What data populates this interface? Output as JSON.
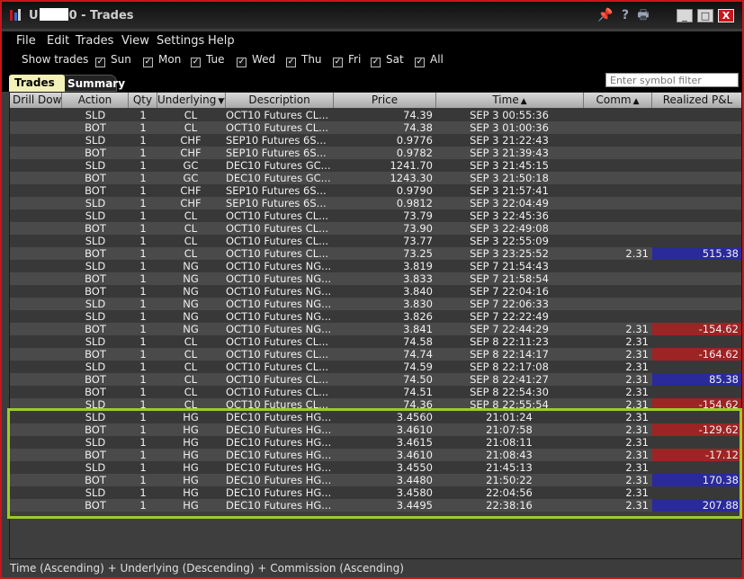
{
  "window": {
    "title_prefix": "U",
    "title_suffix": "0 - Trades"
  },
  "menu": [
    "File",
    "Edit",
    "Trades",
    "View",
    "Settings",
    "Help"
  ],
  "show_trades_label": "Show trades",
  "days": [
    {
      "label": "Sun",
      "checked": true
    },
    {
      "label": "Mon",
      "checked": true
    },
    {
      "label": "Tue",
      "checked": true
    },
    {
      "label": "Wed",
      "checked": true
    },
    {
      "label": "Thu",
      "checked": true
    },
    {
      "label": "Fri",
      "checked": true
    },
    {
      "label": "Sat",
      "checked": true
    },
    {
      "label": "All",
      "checked": true
    }
  ],
  "tabs": {
    "trades": "Trades",
    "summary": "Summary"
  },
  "filter": {
    "placeholder": "Enter symbol filter"
  },
  "columns": {
    "drill": "Drill Down",
    "action": "Action",
    "qty": "Qty",
    "underlying": "Underlying",
    "description": "Description",
    "price": "Price",
    "time": "Time",
    "comm": "Comm",
    "pnl": "Realized P&L"
  },
  "rows": [
    {
      "action": "SLD",
      "qty": "1",
      "und": "CL",
      "desc": "OCT10 Futures CL...",
      "price": "74.39",
      "time": "SEP 3 00:55:36",
      "comm": "",
      "pnl": ""
    },
    {
      "action": "BOT",
      "qty": "1",
      "und": "CL",
      "desc": "OCT10 Futures CL...",
      "price": "74.38",
      "time": "SEP 3 01:00:36",
      "comm": "",
      "pnl": ""
    },
    {
      "action": "SLD",
      "qty": "1",
      "und": "CHF",
      "desc": "SEP10 Futures 6S...",
      "price": "0.9776",
      "time": "SEP 3 21:22:43",
      "comm": "",
      "pnl": ""
    },
    {
      "action": "BOT",
      "qty": "1",
      "und": "CHF",
      "desc": "SEP10 Futures 6S...",
      "price": "0.9782",
      "time": "SEP 3 21:39:43",
      "comm": "",
      "pnl": ""
    },
    {
      "action": "SLD",
      "qty": "1",
      "und": "GC",
      "desc": "DEC10 Futures GC...",
      "price": "1241.70",
      "time": "SEP 3 21:45:15",
      "comm": "",
      "pnl": ""
    },
    {
      "action": "BOT",
      "qty": "1",
      "und": "GC",
      "desc": "DEC10 Futures GC...",
      "price": "1243.30",
      "time": "SEP 3 21:50:18",
      "comm": "",
      "pnl": ""
    },
    {
      "action": "BOT",
      "qty": "1",
      "und": "CHF",
      "desc": "SEP10 Futures 6S...",
      "price": "0.9790",
      "time": "SEP 3 21:57:41",
      "comm": "",
      "pnl": ""
    },
    {
      "action": "SLD",
      "qty": "1",
      "und": "CHF",
      "desc": "SEP10 Futures 6S...",
      "price": "0.9812",
      "time": "SEP 3 22:04:49",
      "comm": "",
      "pnl": ""
    },
    {
      "action": "SLD",
      "qty": "1",
      "und": "CL",
      "desc": "OCT10 Futures CL...",
      "price": "73.79",
      "time": "SEP 3 22:45:36",
      "comm": "",
      "pnl": ""
    },
    {
      "action": "BOT",
      "qty": "1",
      "und": "CL",
      "desc": "OCT10 Futures CL...",
      "price": "73.90",
      "time": "SEP 3 22:49:08",
      "comm": "",
      "pnl": ""
    },
    {
      "action": "SLD",
      "qty": "1",
      "und": "CL",
      "desc": "OCT10 Futures CL...",
      "price": "73.77",
      "time": "SEP 3 22:55:09",
      "comm": "",
      "pnl": ""
    },
    {
      "action": "BOT",
      "qty": "1",
      "und": "CL",
      "desc": "OCT10 Futures CL...",
      "price": "73.25",
      "time": "SEP 3 23:25:52",
      "comm": "2.31",
      "pnl": "515.38",
      "pnl_sign": "pos"
    },
    {
      "action": "SLD",
      "qty": "1",
      "und": "NG",
      "desc": "OCT10 Futures NG...",
      "price": "3.819",
      "time": "SEP 7 21:54:43",
      "comm": "",
      "pnl": ""
    },
    {
      "action": "BOT",
      "qty": "1",
      "und": "NG",
      "desc": "OCT10 Futures NG...",
      "price": "3.833",
      "time": "SEP 7 21:58:54",
      "comm": "",
      "pnl": ""
    },
    {
      "action": "BOT",
      "qty": "1",
      "und": "NG",
      "desc": "OCT10 Futures NG...",
      "price": "3.840",
      "time": "SEP 7 22:04:16",
      "comm": "",
      "pnl": ""
    },
    {
      "action": "SLD",
      "qty": "1",
      "und": "NG",
      "desc": "OCT10 Futures NG...",
      "price": "3.830",
      "time": "SEP 7 22:06:33",
      "comm": "",
      "pnl": ""
    },
    {
      "action": "SLD",
      "qty": "1",
      "und": "NG",
      "desc": "OCT10 Futures NG...",
      "price": "3.826",
      "time": "SEP 7 22:22:49",
      "comm": "",
      "pnl": ""
    },
    {
      "action": "BOT",
      "qty": "1",
      "und": "NG",
      "desc": "OCT10 Futures NG...",
      "price": "3.841",
      "time": "SEP 7 22:44:29",
      "comm": "2.31",
      "pnl": "-154.62",
      "pnl_sign": "neg"
    },
    {
      "action": "SLD",
      "qty": "1",
      "und": "CL",
      "desc": "OCT10 Futures CL...",
      "price": "74.58",
      "time": "SEP 8 22:11:23",
      "comm": "2.31",
      "pnl": ""
    },
    {
      "action": "BOT",
      "qty": "1",
      "und": "CL",
      "desc": "OCT10 Futures CL...",
      "price": "74.74",
      "time": "SEP 8 22:14:17",
      "comm": "2.31",
      "pnl": "-164.62",
      "pnl_sign": "neg"
    },
    {
      "action": "SLD",
      "qty": "1",
      "und": "CL",
      "desc": "OCT10 Futures CL...",
      "price": "74.59",
      "time": "SEP 8 22:17:08",
      "comm": "2.31",
      "pnl": ""
    },
    {
      "action": "BOT",
      "qty": "1",
      "und": "CL",
      "desc": "OCT10 Futures CL...",
      "price": "74.50",
      "time": "SEP 8 22:41:27",
      "comm": "2.31",
      "pnl": "85.38",
      "pnl_sign": "pos"
    },
    {
      "action": "BOT",
      "qty": "1",
      "und": "CL",
      "desc": "OCT10 Futures CL...",
      "price": "74.51",
      "time": "SEP 8 22:54:30",
      "comm": "2.31",
      "pnl": ""
    },
    {
      "action": "SLD",
      "qty": "1",
      "und": "CL",
      "desc": "OCT10 Futures CL...",
      "price": "74.36",
      "time": "SEP 8 22:55:54",
      "comm": "2.31",
      "pnl": "-154.62",
      "pnl_sign": "neg"
    },
    {
      "action": "SLD",
      "qty": "1",
      "und": "HG",
      "desc": "DEC10 Futures HG...",
      "price": "3.4560",
      "time": "21:01:24",
      "comm": "2.31",
      "pnl": ""
    },
    {
      "action": "BOT",
      "qty": "1",
      "und": "HG",
      "desc": "DEC10 Futures HG...",
      "price": "3.4610",
      "time": "21:07:58",
      "comm": "2.31",
      "pnl": "-129.62",
      "pnl_sign": "neg"
    },
    {
      "action": "SLD",
      "qty": "1",
      "und": "HG",
      "desc": "DEC10 Futures HG...",
      "price": "3.4615",
      "time": "21:08:11",
      "comm": "2.31",
      "pnl": ""
    },
    {
      "action": "BOT",
      "qty": "1",
      "und": "HG",
      "desc": "DEC10 Futures HG...",
      "price": "3.4610",
      "time": "21:08:43",
      "comm": "2.31",
      "pnl": "-17.12",
      "pnl_sign": "neg"
    },
    {
      "action": "SLD",
      "qty": "1",
      "und": "HG",
      "desc": "DEC10 Futures HG...",
      "price": "3.4550",
      "time": "21:45:13",
      "comm": "2.31",
      "pnl": ""
    },
    {
      "action": "BOT",
      "qty": "1",
      "und": "HG",
      "desc": "DEC10 Futures HG...",
      "price": "3.4480",
      "time": "21:50:22",
      "comm": "2.31",
      "pnl": "170.38",
      "pnl_sign": "pos"
    },
    {
      "action": "SLD",
      "qty": "1",
      "und": "HG",
      "desc": "DEC10 Futures HG...",
      "price": "3.4580",
      "time": "22:04:56",
      "comm": "2.31",
      "pnl": ""
    },
    {
      "action": "BOT",
      "qty": "1",
      "und": "HG",
      "desc": "DEC10 Futures HG...",
      "price": "3.4495",
      "time": "22:38:16",
      "comm": "2.31",
      "pnl": "207.88",
      "pnl_sign": "pos"
    }
  ],
  "status": "Time (Ascending)  +  Underlying (Descending)  +  Commission (Ascending)",
  "colors": {
    "pnl_positive": "#2a2a9a",
    "pnl_negative": "#9c2424",
    "highlight": "#9ccc2a",
    "window_border": "#c8161d"
  },
  "icons": [
    "app-logo-icon",
    "pin-icon",
    "help-icon",
    "print-icon",
    "minimize-icon",
    "maximize-icon",
    "close-icon"
  ]
}
